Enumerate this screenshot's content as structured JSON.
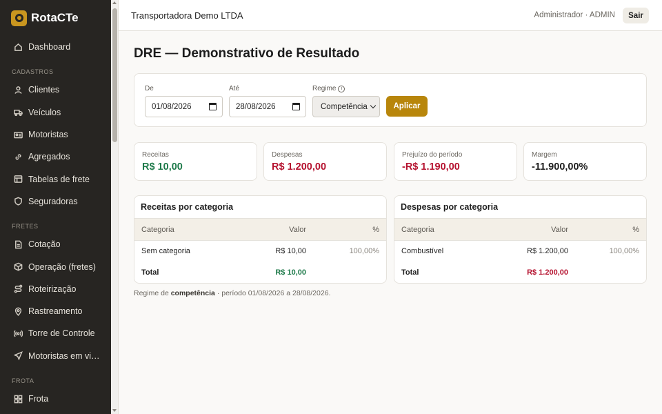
{
  "brand": {
    "name": "RotaCTe",
    "accent": "#c9961f"
  },
  "sidebar": {
    "dashboard": {
      "label": "Dashboard",
      "icon": "home-icon"
    },
    "sections": [
      {
        "title": "CADASTROS",
        "items": [
          {
            "label": "Clientes",
            "icon": "user-icon"
          },
          {
            "label": "Veículos",
            "icon": "truck-icon"
          },
          {
            "label": "Motoristas",
            "icon": "id-card-icon"
          },
          {
            "label": "Agregados",
            "icon": "link-icon"
          },
          {
            "label": "Tabelas de frete",
            "icon": "table-icon"
          },
          {
            "label": "Seguradoras",
            "icon": "shield-icon"
          }
        ]
      },
      {
        "title": "FRETES",
        "items": [
          {
            "label": "Cotação",
            "icon": "document-icon"
          },
          {
            "label": "Operação (fretes)",
            "icon": "package-icon"
          },
          {
            "label": "Roteirização",
            "icon": "route-icon"
          },
          {
            "label": "Rastreamento",
            "icon": "map-pin-icon"
          },
          {
            "label": "Torre de Controle",
            "icon": "broadcast-icon"
          },
          {
            "label": "Motoristas em viag...",
            "icon": "send-icon"
          }
        ]
      },
      {
        "title": "FROTA",
        "items": [
          {
            "label": "Frota",
            "icon": "grid-icon"
          }
        ]
      }
    ]
  },
  "topbar": {
    "company": "Transportadora Demo LTDA",
    "user": "Administrador · ADMIN",
    "logout_label": "Sair"
  },
  "page": {
    "title": "DRE — Demonstrativo de Resultado"
  },
  "filters": {
    "from_label": "De",
    "from_value": "01/08/2026",
    "to_label": "Até",
    "to_value": "28/08/2026",
    "regime_label": "Regime",
    "regime_value": "Competência",
    "apply_label": "Aplicar"
  },
  "kpis": [
    {
      "label": "Receitas",
      "value": "R$ 10,00",
      "color": "#1e7a4a"
    },
    {
      "label": "Despesas",
      "value": "R$ 1.200,00",
      "color": "#b5122f"
    },
    {
      "label": "Prejuízo do período",
      "value": "-R$ 1.190,00",
      "color": "#b5122f"
    },
    {
      "label": "Margem",
      "value": "-11.900,00%",
      "color": "#1f1f1f"
    }
  ],
  "revenue": {
    "title": "Receitas por categoria",
    "headers": {
      "category": "Categoria",
      "value": "Valor",
      "pct": "%"
    },
    "rows": [
      {
        "category": "Sem categoria",
        "value": "R$ 10,00",
        "pct": "100,00%"
      }
    ],
    "total_label": "Total",
    "total_value": "R$ 10,00",
    "total_color": "#1e7a4a"
  },
  "expenses": {
    "title": "Despesas por categoria",
    "headers": {
      "category": "Categoria",
      "value": "Valor",
      "pct": "%"
    },
    "rows": [
      {
        "category": "Combustível",
        "value": "R$ 1.200,00",
        "pct": "100,00%"
      }
    ],
    "total_label": "Total",
    "total_value": "R$ 1.200,00",
    "total_color": "#b5122f"
  },
  "footnote": {
    "prefix": "Regime de ",
    "regime": "competência",
    "suffix": " · período 01/08/2026 a 28/08/2026."
  }
}
